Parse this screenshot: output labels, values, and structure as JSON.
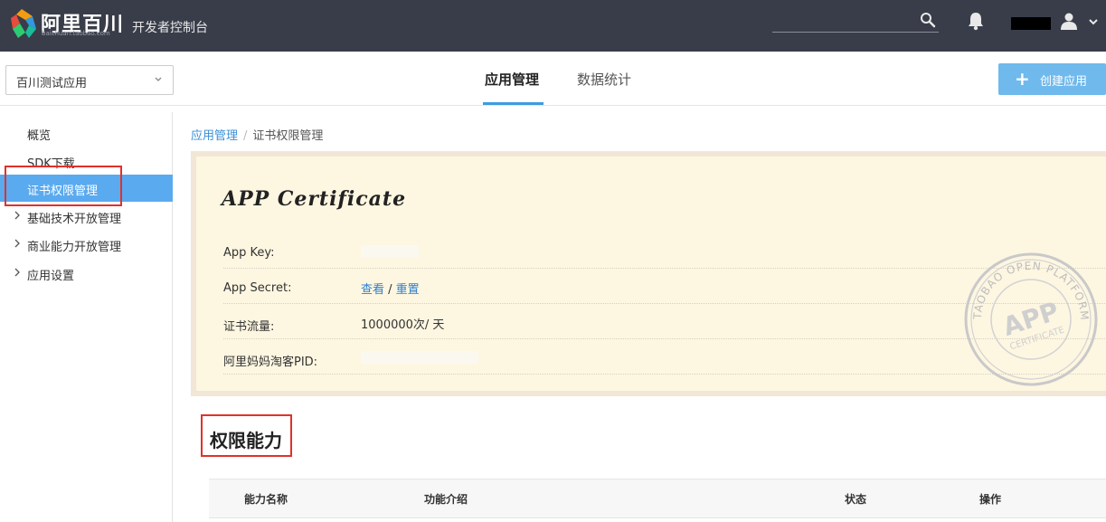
{
  "topbar": {
    "brand": "阿里百川",
    "brand_sub": "baichuan.taobao.com",
    "console_title": "开发者控制台",
    "icons": [
      "search-icon",
      "bell-icon",
      "user-icon",
      "chevron-down-icon"
    ],
    "bg_color": "#393d49"
  },
  "subbar": {
    "app_select_value": "百川测试应用",
    "tabs": [
      {
        "label": "应用管理",
        "active": true
      },
      {
        "label": "数据统计",
        "active": false
      }
    ],
    "create_button": {
      "icon": "+",
      "label": "创建应用"
    },
    "accent_color": "#3b9ddf"
  },
  "sidebar": {
    "items": [
      {
        "label": "概览",
        "expandable": false,
        "active": false
      },
      {
        "label": "SDK下载",
        "expandable": false,
        "active": false
      },
      {
        "label": "证书权限管理",
        "expandable": false,
        "active": true
      },
      {
        "label": "基础技术开放管理",
        "expandable": true,
        "active": false
      },
      {
        "label": "商业能力开放管理",
        "expandable": true,
        "active": false
      },
      {
        "label": "应用设置",
        "expandable": true,
        "active": false
      }
    ]
  },
  "breadcrumb": {
    "root": "应用管理",
    "separator": "/",
    "current": "证书权限管理"
  },
  "certificate": {
    "title": "APP Certificate",
    "rows": [
      {
        "label": "App Key:",
        "value": ""
      },
      {
        "label": "App Secret:",
        "view_link": "查看",
        "sep": " / ",
        "reset_link": "重置"
      },
      {
        "label": "证书流量:",
        "value": "1000000次/ 天"
      },
      {
        "label": "阿里妈妈淘客PID:",
        "value": ""
      }
    ],
    "stamp": {
      "ring_text": "TAOBAO OPEN PLATFORM",
      "center": "APP",
      "sub": "CERTIFICATE"
    }
  },
  "section": {
    "title": "权限能力"
  },
  "table": {
    "columns": [
      "能力名称",
      "功能介绍",
      "状态",
      "操作"
    ]
  }
}
